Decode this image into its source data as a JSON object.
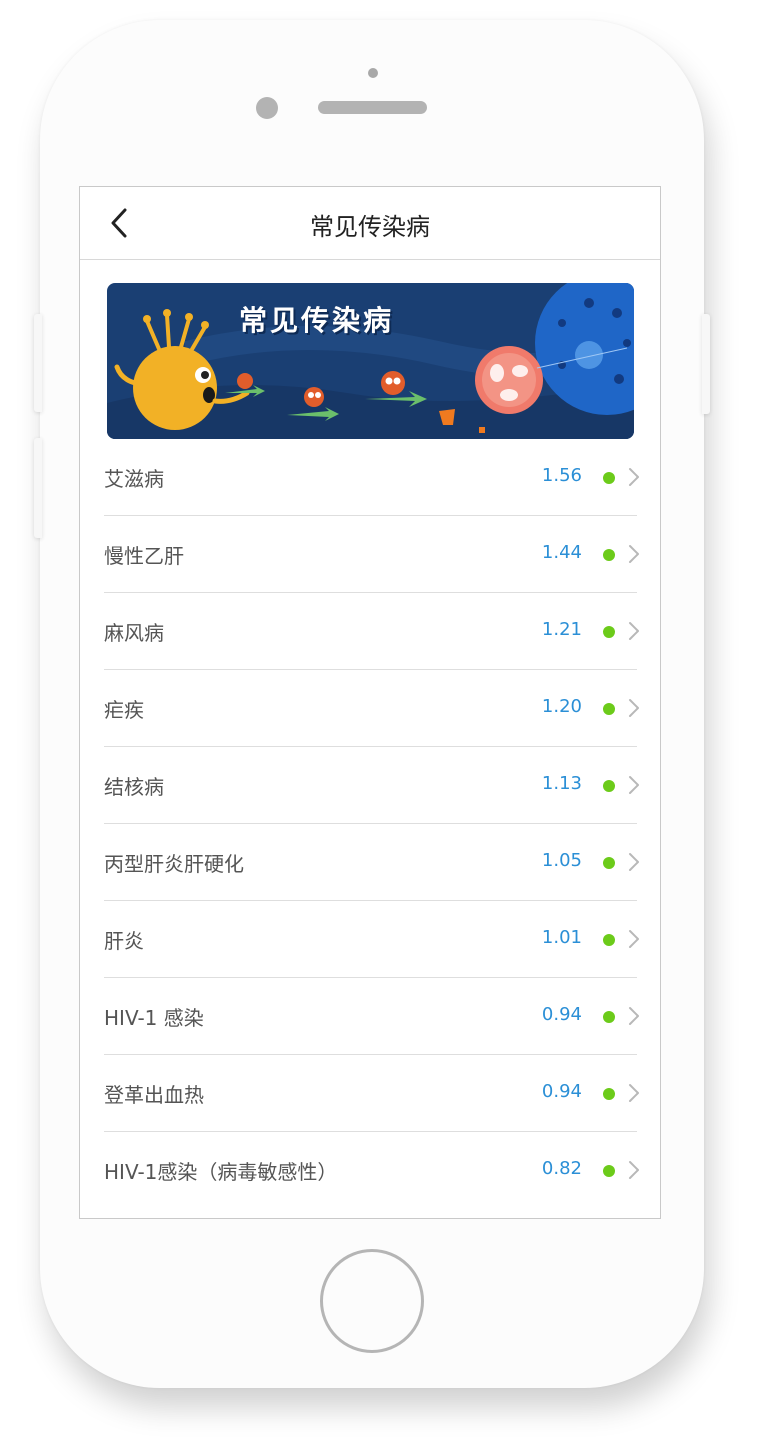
{
  "header": {
    "title": "常见传染病"
  },
  "banner": {
    "title": "常见传染病"
  },
  "colors": {
    "value_text": "#2b8fd6",
    "status_dot": "#6ccb1a",
    "banner_bg": "#1a3f73"
  },
  "diseases": [
    {
      "name": "艾滋病",
      "value": "1.56"
    },
    {
      "name": "慢性乙肝",
      "value": "1.44"
    },
    {
      "name": "麻风病",
      "value": "1.21"
    },
    {
      "name": "疟疾",
      "value": "1.20"
    },
    {
      "name": "结核病",
      "value": "1.13"
    },
    {
      "name": "丙型肝炎肝硬化",
      "value": "1.05"
    },
    {
      "name": "肝炎",
      "value": "1.01"
    },
    {
      "name": "HIV-1 感染",
      "value": "0.94"
    },
    {
      "name": "登革出血热",
      "value": "0.94"
    },
    {
      "name": "HIV-1感染（病毒敏感性）",
      "value": "0.82"
    }
  ],
  "icons": {
    "back": "chevron-left-icon",
    "row_arrow": "chevron-right-icon",
    "status": "status-dot-icon"
  }
}
